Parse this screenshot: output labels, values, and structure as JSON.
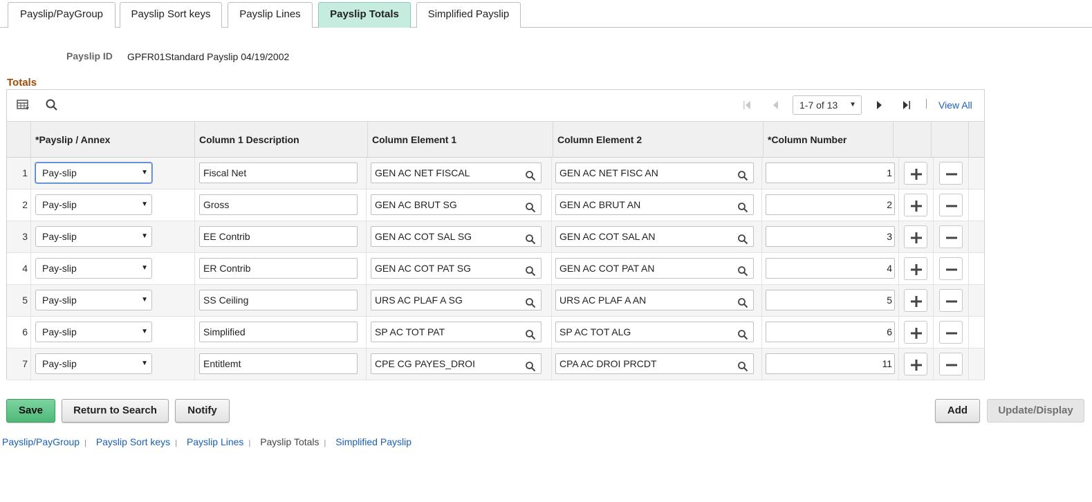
{
  "tabs": [
    {
      "label": "Payslip/PayGroup",
      "active": false
    },
    {
      "label": "Payslip Sort keys",
      "active": false
    },
    {
      "label": "Payslip Lines",
      "active": false
    },
    {
      "label": "Payslip Totals",
      "active": true
    },
    {
      "label": "Simplified Payslip",
      "active": false
    }
  ],
  "header": {
    "payslip_id_label": "Payslip ID",
    "payslip_id_value": "GPFR01Standard Payslip 04/19/2002",
    "section_title": "Totals"
  },
  "grid": {
    "pager": "1-7 of 13",
    "view_all": "View All",
    "columns": [
      "*Payslip / Annex",
      "Column 1 Description",
      "Column Element 1",
      "Column Element 2",
      "*Column Number"
    ],
    "rows": [
      {
        "num": "1",
        "annex": "Pay-slip",
        "desc": "Fiscal Net",
        "elem1": "GEN AC NET FISCAL",
        "elem2": "GEN AC NET FISC AN",
        "colnum": "1"
      },
      {
        "num": "2",
        "annex": "Pay-slip",
        "desc": "Gross",
        "elem1": "GEN AC BRUT SG",
        "elem2": "GEN AC BRUT AN",
        "colnum": "2"
      },
      {
        "num": "3",
        "annex": "Pay-slip",
        "desc": "EE Contrib",
        "elem1": "GEN AC COT SAL SG",
        "elem2": "GEN AC COT SAL AN",
        "colnum": "3"
      },
      {
        "num": "4",
        "annex": "Pay-slip",
        "desc": "ER Contrib",
        "elem1": "GEN AC COT PAT SG",
        "elem2": "GEN AC COT PAT AN",
        "colnum": "4"
      },
      {
        "num": "5",
        "annex": "Pay-slip",
        "desc": "SS Ceiling",
        "elem1": "URS AC PLAF A SG",
        "elem2": "URS AC PLAF A AN",
        "colnum": "5"
      },
      {
        "num": "6",
        "annex": "Pay-slip",
        "desc": "Simplified",
        "elem1": "SP AC TOT PAT",
        "elem2": "SP AC TOT ALG",
        "colnum": "6"
      },
      {
        "num": "7",
        "annex": "Pay-slip",
        "desc": "Entitlemt",
        "elem1": "CPE CG PAYES_DROI",
        "elem2": "CPA AC DROI PRCDT",
        "colnum": "11"
      }
    ]
  },
  "buttons": {
    "save": "Save",
    "return_to_search": "Return to Search",
    "notify": "Notify",
    "add": "Add",
    "update_display": "Update/Display"
  },
  "footer_links": [
    {
      "label": "Payslip/PayGroup",
      "current": false
    },
    {
      "label": "Payslip Sort keys",
      "current": false
    },
    {
      "label": "Payslip Lines",
      "current": false
    },
    {
      "label": "Payslip Totals",
      "current": true
    },
    {
      "label": "Simplified Payslip",
      "current": false
    }
  ],
  "colors": {
    "active_tab": "#c6ece0",
    "section_title": "#9c4b0a",
    "link": "#1a5fb4",
    "primary_button": "#50b979"
  }
}
